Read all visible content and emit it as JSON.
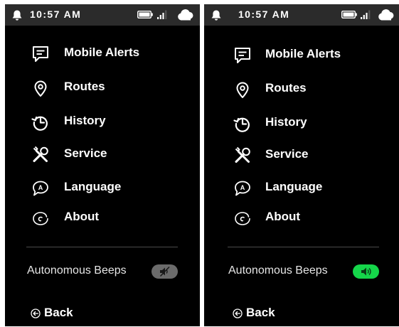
{
  "colors": {
    "screen_bg": "#000000",
    "status_bar_bg": "#2b2b2b",
    "toggle_off": "#6b6b6b",
    "toggle_on": "#15d64a"
  },
  "screens": [
    {
      "status": {
        "time": "10:57 AM"
      },
      "menu": [
        {
          "label": "Mobile Alerts",
          "icon": "message-icon"
        },
        {
          "label": "Routes",
          "icon": "location-pin-icon"
        },
        {
          "label": "History",
          "icon": "history-icon"
        },
        {
          "label": "Service",
          "icon": "tools-icon"
        },
        {
          "label": "Language",
          "icon": "language-icon"
        },
        {
          "label": "About",
          "icon": "about-icon"
        }
      ],
      "beeps": {
        "label": "Autonomous Beeps",
        "enabled": false,
        "icon": "speaker-muted-icon"
      },
      "back_label": "Back"
    },
    {
      "status": {
        "time": "10:57 AM"
      },
      "menu": [
        {
          "label": "Mobile Alerts",
          "icon": "message-icon"
        },
        {
          "label": "Routes",
          "icon": "location-pin-icon"
        },
        {
          "label": "History",
          "icon": "history-icon"
        },
        {
          "label": "Service",
          "icon": "tools-icon"
        },
        {
          "label": "Language",
          "icon": "language-icon"
        },
        {
          "label": "About",
          "icon": "about-icon"
        }
      ],
      "beeps": {
        "label": "Autonomous Beeps",
        "enabled": true,
        "icon": "speaker-on-icon"
      },
      "back_label": "Back"
    }
  ]
}
